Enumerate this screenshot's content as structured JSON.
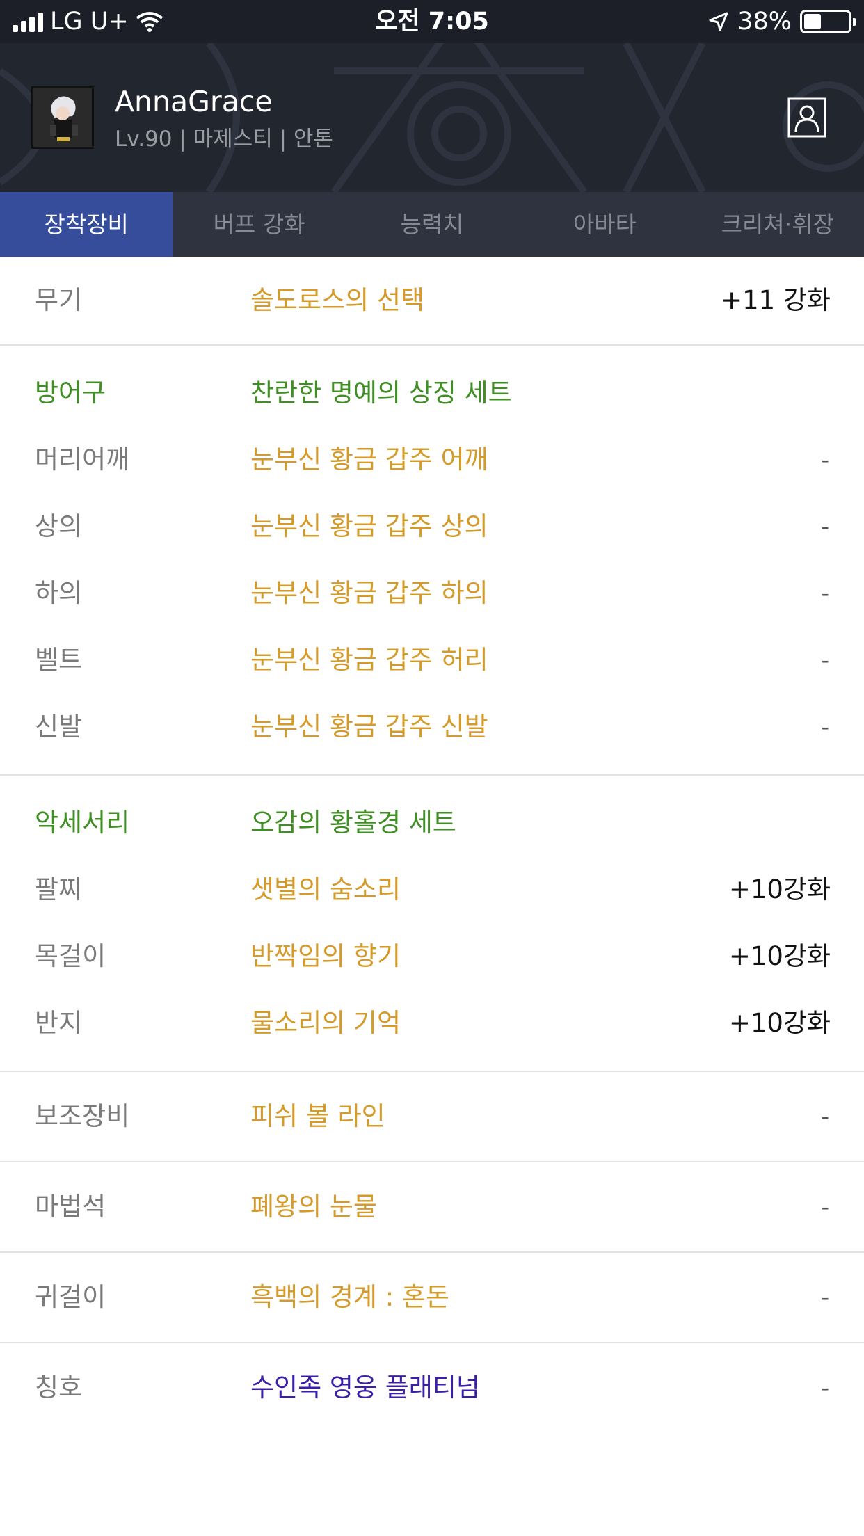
{
  "status_bar": {
    "carrier": "LG U+",
    "time": "오전 7:05",
    "battery": "38%",
    "battery_level": 0.38
  },
  "header": {
    "name": "AnnaGrace",
    "info": "Lv.90 | 마제스티 | 안톤"
  },
  "tabs": [
    "장착장비",
    "버프 강화",
    "능력치",
    "아바타",
    "크리쳐·휘장"
  ],
  "equipment": {
    "weapon": {
      "slot": "무기",
      "item": "솔도로스의 선택",
      "enh": "+11 강화"
    },
    "armor": {
      "header": {
        "slot": "방어구",
        "item": "찬란한 명예의 상징 세트"
      },
      "rows": [
        {
          "slot": "머리어깨",
          "item": "눈부신 황금 갑주 어깨",
          "enh": "-"
        },
        {
          "slot": "상의",
          "item": "눈부신 황금 갑주 상의",
          "enh": "-"
        },
        {
          "slot": "하의",
          "item": "눈부신 황금 갑주 하의",
          "enh": "-"
        },
        {
          "slot": "벨트",
          "item": "눈부신 황금 갑주 허리",
          "enh": "-"
        },
        {
          "slot": "신발",
          "item": "눈부신 황금 갑주 신발",
          "enh": "-"
        }
      ]
    },
    "accessory": {
      "header": {
        "slot": "악세서리",
        "item": "오감의 황홀경 세트"
      },
      "rows": [
        {
          "slot": "팔찌",
          "item": "샛별의 숨소리",
          "enh": "+10강화"
        },
        {
          "slot": "목걸이",
          "item": "반짝임의 향기",
          "enh": "+10강화"
        },
        {
          "slot": "반지",
          "item": "물소리의 기억",
          "enh": "+10강화"
        }
      ]
    },
    "sub": {
      "slot": "보조장비",
      "item": "피쉬 볼 라인",
      "enh": "-"
    },
    "magic": {
      "slot": "마법석",
      "item": "폐왕의 눈물",
      "enh": "-"
    },
    "earring": {
      "slot": "귀걸이",
      "item": "흑백의 경계 : 혼돈",
      "enh": "-"
    },
    "title": {
      "slot": "칭호",
      "item": "수인족 영웅 플래티넘",
      "enh": "-"
    }
  },
  "colors": {
    "item_gold": "#d49a2a",
    "set_green": "#3f8f25",
    "title_purple": "#3b1fa8",
    "tab_active": "#354d9a"
  }
}
